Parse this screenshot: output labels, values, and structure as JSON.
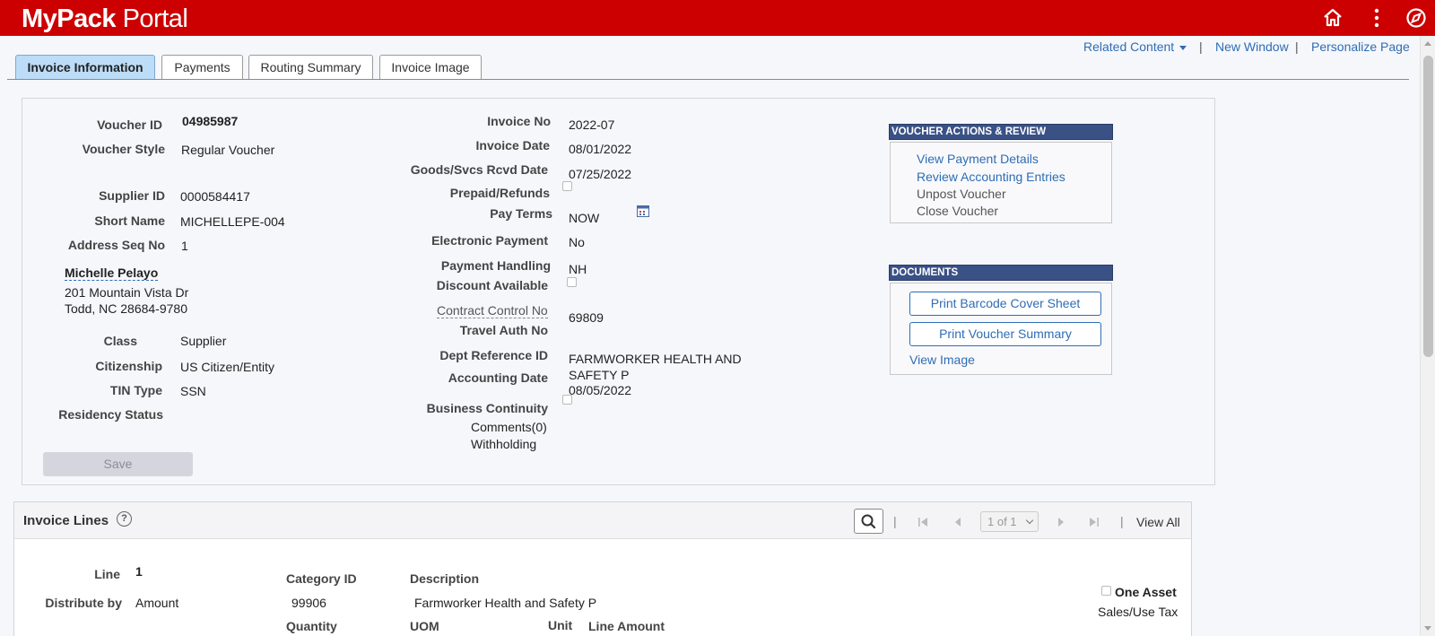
{
  "header": {
    "brand_bold": "MyPack",
    "brand_rest": " Portal",
    "home_icon": "home-icon",
    "menu_icon": "vertical-dots-icon",
    "navbar_icon": "compass-icon"
  },
  "related": {
    "related_content": "Related Content",
    "new_window": "New Window",
    "personalize_page": "Personalize Page",
    "separator": "|"
  },
  "tabs": [
    {
      "label": "Invoice Information"
    },
    {
      "label": "Payments"
    },
    {
      "label": "Routing Summary"
    },
    {
      "label": "Invoice Image"
    }
  ],
  "left": {
    "voucher_id_label": "Voucher ID",
    "voucher_id": "04985987",
    "voucher_style_label": "Voucher Style",
    "voucher_style": "Regular Voucher",
    "supplier_id_label": "Supplier ID",
    "supplier_id": "0000584417",
    "short_name_label": "Short Name",
    "short_name": "MICHELLEPE-004",
    "address_seq_label": "Address Seq No",
    "address_seq": "1",
    "supplier_name": "Michelle Pelayo",
    "address_line1": "201 Mountain Vista Dr",
    "address_line2": "Todd, NC  28684-9780",
    "class_label": "Class",
    "class": "Supplier",
    "citizenship_label": "Citizenship",
    "citizenship": "US Citizen/Entity",
    "tin_type_label": "TIN Type",
    "tin_type": "SSN",
    "residency_label": "Residency Status",
    "save_label": "Save"
  },
  "middle": {
    "invoice_no_label": "Invoice No",
    "invoice_no": "2022-07",
    "invoice_date_label": "Invoice Date",
    "invoice_date": "08/01/2022",
    "goods_rcvd_label": "Goods/Svcs Rcvd Date",
    "goods_rcvd": "07/25/2022",
    "prepaid_label": "Prepaid/Refunds",
    "pay_terms_label": "Pay Terms",
    "pay_terms": "NOW",
    "electronic_payment_label": "Electronic Payment",
    "electronic_payment": "No",
    "payment_handling_label": "Payment Handling",
    "payment_handling": "NH",
    "discount_label": "Discount Available",
    "contract_label": "Contract Control No",
    "travel_auth_label": "Travel Auth No",
    "travel_auth": "69809",
    "dept_ref_label": "Dept Reference ID",
    "dept_ref_line1": "FARMWORKER HEALTH AND",
    "dept_ref_line2": "SAFETY P",
    "accounting_date_label": "Accounting Date",
    "accounting_date": "08/05/2022",
    "business_continuity_label": "Business Continuity",
    "comments_link": "Comments(0)",
    "withholding_link": "Withholding"
  },
  "voucher_actions": {
    "header": "VOUCHER ACTIONS & REVIEW",
    "view_payment": "View Payment Details",
    "review_accounting": "Review Accounting Entries",
    "unpost": "Unpost Voucher",
    "close": "Close Voucher"
  },
  "documents": {
    "header": "DOCUMENTS",
    "print_barcode": "Print Barcode Cover Sheet",
    "print_summary": "Print Voucher Summary",
    "view_image": "View Image"
  },
  "invoice_lines": {
    "title": "Invoice Lines",
    "help_glyph": "?",
    "pager": "1 of 1",
    "view_all": "View All",
    "separator": "|",
    "line_label": "Line",
    "line": "1",
    "distribute_label": "Distribute by",
    "distribute": "Amount",
    "category_label": "Category ID",
    "category": "99906",
    "description_label": "Description",
    "description": "Farmworker Health and Safety P",
    "one_asset_label": "One Asset",
    "sales_tax_link": "Sales/Use Tax",
    "quantity_label": "Quantity",
    "uom_label": "UOM",
    "unit_price_label": "Unit",
    "line_amount_label": "Line Amount"
  }
}
